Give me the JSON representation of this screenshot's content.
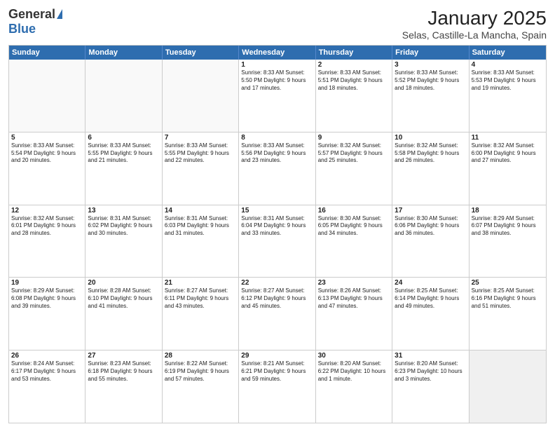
{
  "header": {
    "logo_general": "General",
    "logo_blue": "Blue",
    "month_title": "January 2025",
    "location": "Selas, Castille-La Mancha, Spain"
  },
  "weekdays": [
    "Sunday",
    "Monday",
    "Tuesday",
    "Wednesday",
    "Thursday",
    "Friday",
    "Saturday"
  ],
  "rows": [
    [
      {
        "day": "",
        "text": "",
        "empty": true
      },
      {
        "day": "",
        "text": "",
        "empty": true
      },
      {
        "day": "",
        "text": "",
        "empty": true
      },
      {
        "day": "1",
        "text": "Sunrise: 8:33 AM\nSunset: 5:50 PM\nDaylight: 9 hours\nand 17 minutes."
      },
      {
        "day": "2",
        "text": "Sunrise: 8:33 AM\nSunset: 5:51 PM\nDaylight: 9 hours\nand 18 minutes."
      },
      {
        "day": "3",
        "text": "Sunrise: 8:33 AM\nSunset: 5:52 PM\nDaylight: 9 hours\nand 18 minutes."
      },
      {
        "day": "4",
        "text": "Sunrise: 8:33 AM\nSunset: 5:53 PM\nDaylight: 9 hours\nand 19 minutes."
      }
    ],
    [
      {
        "day": "5",
        "text": "Sunrise: 8:33 AM\nSunset: 5:54 PM\nDaylight: 9 hours\nand 20 minutes."
      },
      {
        "day": "6",
        "text": "Sunrise: 8:33 AM\nSunset: 5:55 PM\nDaylight: 9 hours\nand 21 minutes."
      },
      {
        "day": "7",
        "text": "Sunrise: 8:33 AM\nSunset: 5:55 PM\nDaylight: 9 hours\nand 22 minutes."
      },
      {
        "day": "8",
        "text": "Sunrise: 8:33 AM\nSunset: 5:56 PM\nDaylight: 9 hours\nand 23 minutes."
      },
      {
        "day": "9",
        "text": "Sunrise: 8:32 AM\nSunset: 5:57 PM\nDaylight: 9 hours\nand 25 minutes."
      },
      {
        "day": "10",
        "text": "Sunrise: 8:32 AM\nSunset: 5:58 PM\nDaylight: 9 hours\nand 26 minutes."
      },
      {
        "day": "11",
        "text": "Sunrise: 8:32 AM\nSunset: 6:00 PM\nDaylight: 9 hours\nand 27 minutes."
      }
    ],
    [
      {
        "day": "12",
        "text": "Sunrise: 8:32 AM\nSunset: 6:01 PM\nDaylight: 9 hours\nand 28 minutes."
      },
      {
        "day": "13",
        "text": "Sunrise: 8:31 AM\nSunset: 6:02 PM\nDaylight: 9 hours\nand 30 minutes."
      },
      {
        "day": "14",
        "text": "Sunrise: 8:31 AM\nSunset: 6:03 PM\nDaylight: 9 hours\nand 31 minutes."
      },
      {
        "day": "15",
        "text": "Sunrise: 8:31 AM\nSunset: 6:04 PM\nDaylight: 9 hours\nand 33 minutes."
      },
      {
        "day": "16",
        "text": "Sunrise: 8:30 AM\nSunset: 6:05 PM\nDaylight: 9 hours\nand 34 minutes."
      },
      {
        "day": "17",
        "text": "Sunrise: 8:30 AM\nSunset: 6:06 PM\nDaylight: 9 hours\nand 36 minutes."
      },
      {
        "day": "18",
        "text": "Sunrise: 8:29 AM\nSunset: 6:07 PM\nDaylight: 9 hours\nand 38 minutes."
      }
    ],
    [
      {
        "day": "19",
        "text": "Sunrise: 8:29 AM\nSunset: 6:08 PM\nDaylight: 9 hours\nand 39 minutes."
      },
      {
        "day": "20",
        "text": "Sunrise: 8:28 AM\nSunset: 6:10 PM\nDaylight: 9 hours\nand 41 minutes."
      },
      {
        "day": "21",
        "text": "Sunrise: 8:27 AM\nSunset: 6:11 PM\nDaylight: 9 hours\nand 43 minutes."
      },
      {
        "day": "22",
        "text": "Sunrise: 8:27 AM\nSunset: 6:12 PM\nDaylight: 9 hours\nand 45 minutes."
      },
      {
        "day": "23",
        "text": "Sunrise: 8:26 AM\nSunset: 6:13 PM\nDaylight: 9 hours\nand 47 minutes."
      },
      {
        "day": "24",
        "text": "Sunrise: 8:25 AM\nSunset: 6:14 PM\nDaylight: 9 hours\nand 49 minutes."
      },
      {
        "day": "25",
        "text": "Sunrise: 8:25 AM\nSunset: 6:16 PM\nDaylight: 9 hours\nand 51 minutes."
      }
    ],
    [
      {
        "day": "26",
        "text": "Sunrise: 8:24 AM\nSunset: 6:17 PM\nDaylight: 9 hours\nand 53 minutes."
      },
      {
        "day": "27",
        "text": "Sunrise: 8:23 AM\nSunset: 6:18 PM\nDaylight: 9 hours\nand 55 minutes."
      },
      {
        "day": "28",
        "text": "Sunrise: 8:22 AM\nSunset: 6:19 PM\nDaylight: 9 hours\nand 57 minutes."
      },
      {
        "day": "29",
        "text": "Sunrise: 8:21 AM\nSunset: 6:21 PM\nDaylight: 9 hours\nand 59 minutes."
      },
      {
        "day": "30",
        "text": "Sunrise: 8:20 AM\nSunset: 6:22 PM\nDaylight: 10 hours\nand 1 minute."
      },
      {
        "day": "31",
        "text": "Sunrise: 8:20 AM\nSunset: 6:23 PM\nDaylight: 10 hours\nand 3 minutes."
      },
      {
        "day": "",
        "text": "",
        "empty": true,
        "shaded": true
      }
    ]
  ]
}
